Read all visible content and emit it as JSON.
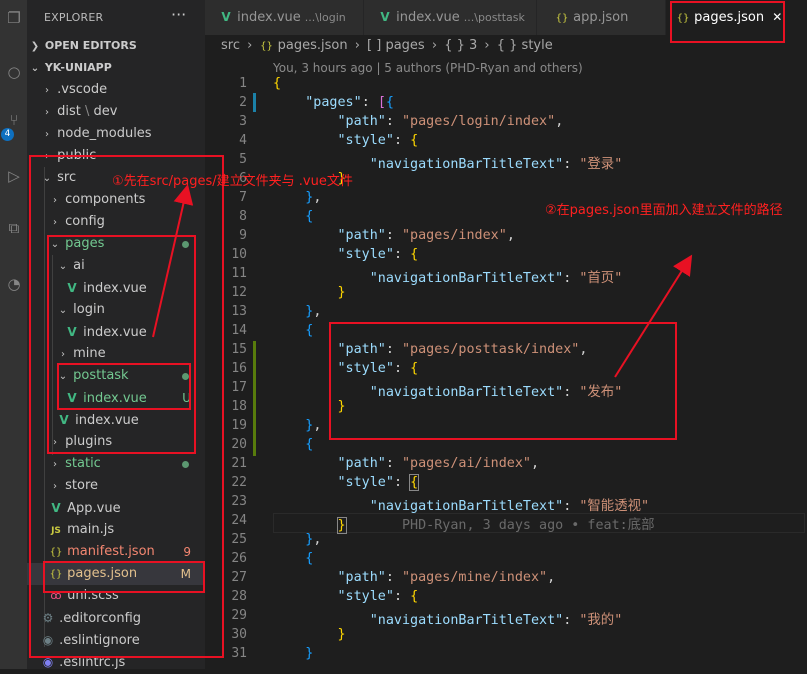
{
  "explorer": {
    "title": "EXPLORER",
    "more": "···",
    "open_editors": "OPEN EDITORS",
    "project": "YK-UNIAPP",
    "items": [
      {
        "label": ".vscode"
      },
      {
        "label": "dist",
        "suffix": "dev"
      },
      {
        "label": "node_modules"
      },
      {
        "label": "public"
      },
      {
        "label": "src"
      },
      {
        "label": "components"
      },
      {
        "label": "config"
      },
      {
        "label": "pages"
      },
      {
        "label": "ai"
      },
      {
        "label": "index.vue"
      },
      {
        "label": "login"
      },
      {
        "label": "index.vue"
      },
      {
        "label": "mine"
      },
      {
        "label": "posttask"
      },
      {
        "label": "index.vue",
        "status": "U"
      },
      {
        "label": "index.vue"
      },
      {
        "label": "plugins"
      },
      {
        "label": "static"
      },
      {
        "label": "store"
      },
      {
        "label": "App.vue"
      },
      {
        "label": "main.js"
      },
      {
        "label": "manifest.json",
        "status": "9"
      },
      {
        "label": "pages.json",
        "status": "M"
      },
      {
        "label": "uni.scss"
      },
      {
        "label": ".editorconfig"
      },
      {
        "label": ".eslintignore"
      },
      {
        "label": ".eslintrc.js"
      }
    ]
  },
  "tabs": [
    {
      "label": "index.vue",
      "sub": "...\\login"
    },
    {
      "label": "index.vue",
      "sub": "...\\posttask"
    },
    {
      "label": "app.json",
      "sub": ""
    },
    {
      "label": "pages.json",
      "sub": "",
      "close": "✕"
    }
  ],
  "breadcrumb": {
    "src": "src",
    "file": "pages.json",
    "arr": "[ ] pages",
    "obj": "{ } 3",
    "key": "{ } style"
  },
  "blame": "You, 3 hours ago | 5 authors (PHD-Ryan and others)",
  "inline_blame": "PHD-Ryan, 3 days ago • feat:底部",
  "annotations": {
    "step1": "①先在src/pages/建立文件夹与 .vue文件",
    "step2": "②在pages.json里面加入建立文件的路径"
  },
  "code": {
    "pages_key": "\"pages\"",
    "path_key": "\"path\"",
    "style_key": "\"style\"",
    "nav_key": "\"navigationBarTitleText\"",
    "entries": [
      {
        "path": "\"pages/login/index\"",
        "title": "\"登录\""
      },
      {
        "path": "\"pages/index\"",
        "title": "\"首页\""
      },
      {
        "path": "\"pages/posttask/index\"",
        "title": "\"发布\""
      },
      {
        "path": "\"pages/ai/index\"",
        "title": "\"智能透视\""
      },
      {
        "path": "\"pages/mine/index\"",
        "title": "\"我的\""
      }
    ]
  },
  "line_numbers": [
    "1",
    "2",
    "3",
    "4",
    "5",
    "6",
    "7",
    "8",
    "9",
    "10",
    "11",
    "12",
    "13",
    "14",
    "15",
    "16",
    "17",
    "18",
    "19",
    "20",
    "21",
    "22",
    "23",
    "24",
    "25",
    "26",
    "27",
    "28",
    "29",
    "30",
    "31"
  ],
  "colors": {
    "accent": "#007acc",
    "annotation": "#e81123",
    "vue": "#41b883"
  }
}
